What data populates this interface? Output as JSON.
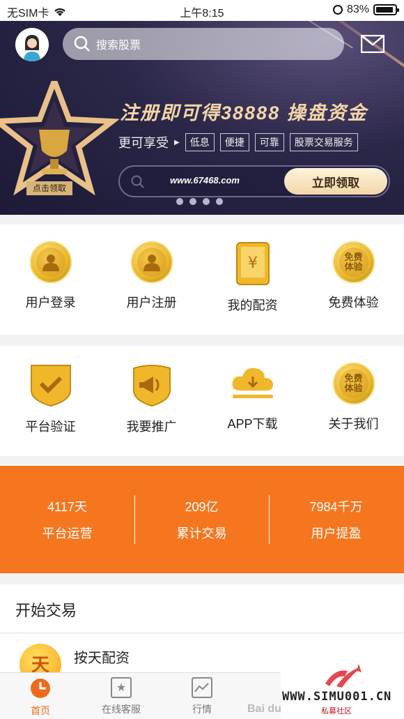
{
  "status_bar": {
    "carrier": "无SIM卡",
    "time": "上午8:15",
    "battery": "83%"
  },
  "banner": {
    "search_placeholder": "搜索股票",
    "headline": "注册即可得38888 操盘资金",
    "sub_prefix": "更可享受",
    "tags": [
      "低息",
      "便捷",
      "可靠",
      "股票交易服务"
    ],
    "url": "www.67468.com",
    "claim_button": "立即领取",
    "trophy_label": "点击领取",
    "page_count": 4
  },
  "menu_row1": [
    {
      "label": "用户登录",
      "icon": "user-coin-icon"
    },
    {
      "label": "用户注册",
      "icon": "user-coin-icon"
    },
    {
      "label": "我的配资",
      "icon": "yuan-tablet-icon"
    },
    {
      "label": "免费体验",
      "icon": "free-trial-coin-icon",
      "icon_text": "免费体验"
    }
  ],
  "menu_row2": [
    {
      "label": "平台验证",
      "icon": "check-shield-icon"
    },
    {
      "label": "我要推广",
      "icon": "megaphone-shield-icon"
    },
    {
      "label": "APP下载",
      "icon": "cloud-download-icon"
    },
    {
      "label": "关于我们",
      "icon": "free-trial-coin-icon",
      "icon_text": "免费体验"
    }
  ],
  "stats": [
    {
      "value": "4117天",
      "label": "平台运营"
    },
    {
      "value": "209亿",
      "label": "累计交易"
    },
    {
      "value": "7984千万",
      "label": "用户提盈"
    }
  ],
  "start_trading": {
    "title": "开始交易",
    "first_item": "按天配资",
    "first_icon_text": "天"
  },
  "tabbar": [
    {
      "label": "首页",
      "active": true
    },
    {
      "label": "在线客服"
    },
    {
      "label": "行情"
    }
  ],
  "watermark": {
    "url": "WWW.SIMU001.CN",
    "sub": "私募社区",
    "baidu": "Bai du"
  },
  "colors": {
    "accent": "#f5761f",
    "tab_active": "#f06a1c",
    "gold": "#e9b82b"
  }
}
